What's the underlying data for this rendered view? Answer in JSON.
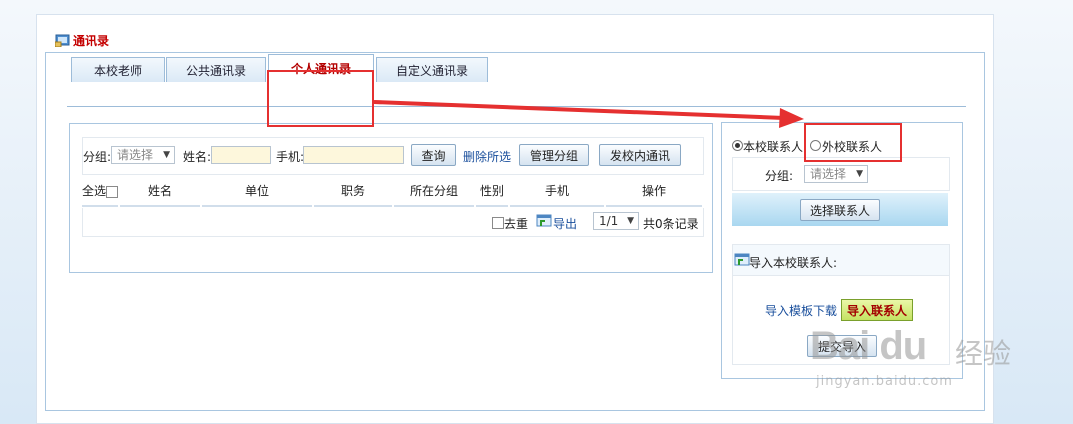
{
  "page": {
    "title": "通讯录"
  },
  "tabs": [
    {
      "label": "本校老师",
      "active": false
    },
    {
      "label": "公共通讯录",
      "active": false
    },
    {
      "label": "个人通讯录",
      "active": true
    },
    {
      "label": "自定义通讯录",
      "active": false
    }
  ],
  "search": {
    "group_label": "分组:",
    "group_select_value": "请选择",
    "name_label": "姓名:",
    "phone_label": "手机:",
    "query_button": "查询",
    "delete_selected_link": "删除所选",
    "manage_group_button": "管理分组",
    "send_notice_button": "发校内通讯"
  },
  "table": {
    "select_all_label": "全选",
    "columns": [
      "姓名",
      "单位",
      "职务",
      "所在分组",
      "性别",
      "手机",
      "操作"
    ]
  },
  "pager": {
    "dedupe_label": "去重",
    "export_label": "导出",
    "page_value": "1/1",
    "record_count_text": "共0条记录"
  },
  "contacts_panel": {
    "radio_local": "本校联系人",
    "radio_external": "外校联系人",
    "selected_radio": "本校联系人",
    "group_label": "分组:",
    "group_select_value": "请选择",
    "select_contacts_button": "选择联系人",
    "import_header": "导入本校联系人:",
    "template_download_link": "导入模板下载",
    "import_button": "导入联系人",
    "submit_button": "提交导入"
  },
  "watermark": {
    "brand": "Bai du",
    "brand_cn": "经验",
    "url": "jingyan.baidu.com"
  },
  "colors": {
    "title_red": "#c40000",
    "annotation_red": "#e53030",
    "border_blue": "#a9c6e0",
    "link_blue": "#1a4f9c"
  }
}
